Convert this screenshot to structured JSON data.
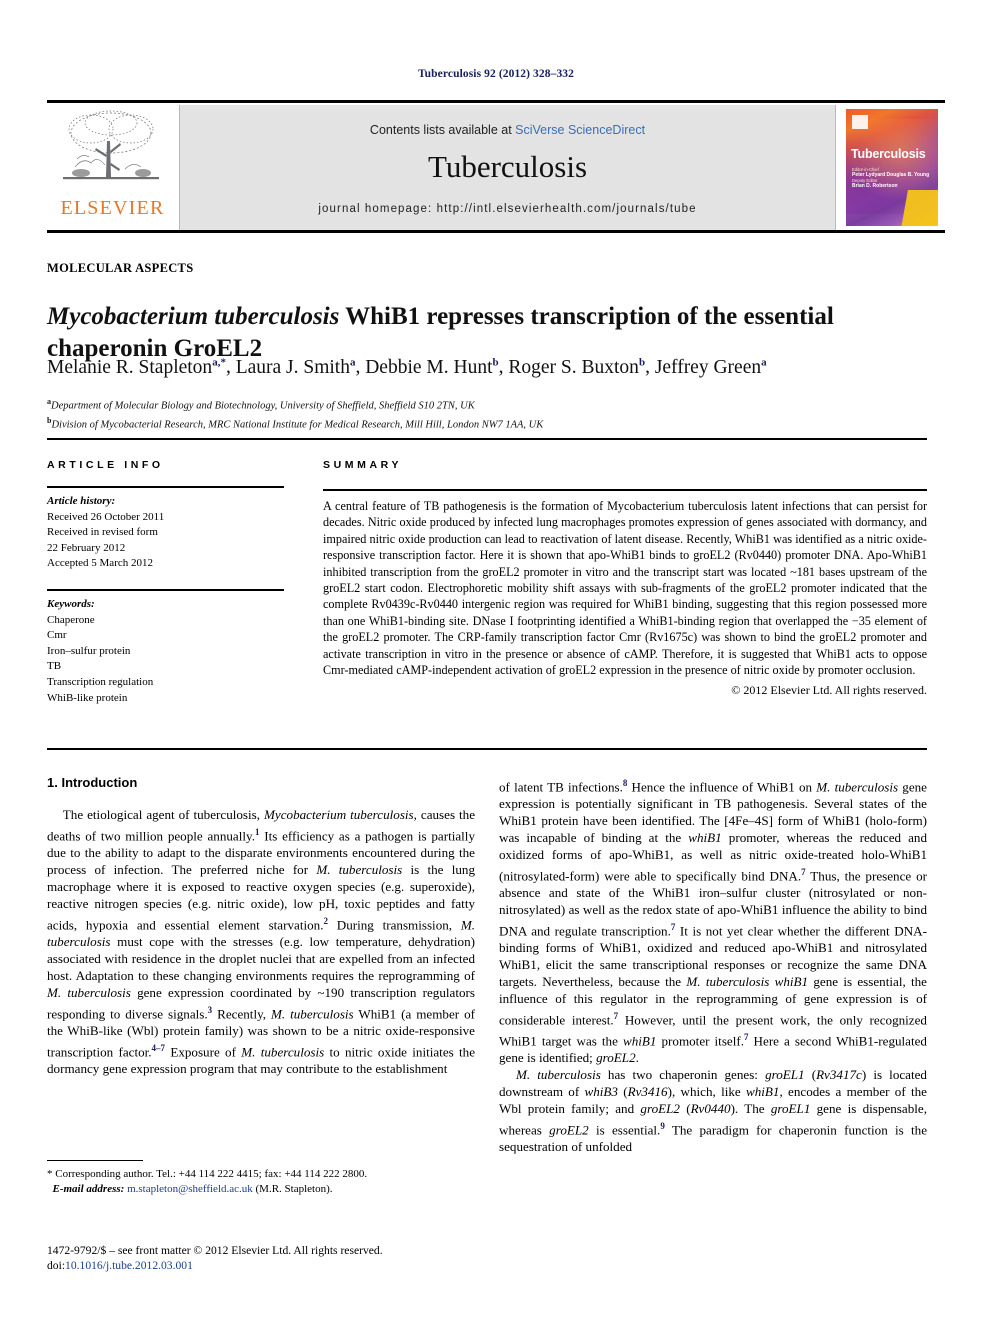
{
  "running_head": "Tuberculosis 92 (2012) 328–332",
  "masthead": {
    "contents_prefix": "Contents lists available at ",
    "sciencedirect": "SciVerse ScienceDirect",
    "journal_name": "Tuberculosis",
    "homepage": "journal homepage: http://intl.elsevierhealth.com/journals/tube",
    "publisher_wordmark": "ELSEVIER",
    "cover": {
      "title": "Tuberculosis",
      "editor_label": "Editor-in-Chief",
      "editors": "Peter Lydyard\nDouglas B. Young",
      "deputy_label": "Deputy Editor",
      "deputy": "Brian D. Robertson",
      "colors": {
        "orange": "#f05a28",
        "purple": "#8e44ad",
        "yellow": "#f5c518"
      }
    }
  },
  "section_label": "MOLECULAR ASPECTS",
  "title": {
    "italic_lead": "Mycobacterium tuberculosis",
    "rest": " WhiB1 represses transcription of the essential chaperonin GroEL2"
  },
  "authors": [
    {
      "name": "Melanie R. Stapleton",
      "marks": "a,*"
    },
    {
      "name": "Laura J. Smith",
      "marks": "a"
    },
    {
      "name": "Debbie M. Hunt",
      "marks": "b"
    },
    {
      "name": "Roger S. Buxton",
      "marks": "b"
    },
    {
      "name": "Jeffrey Green",
      "marks": "a"
    }
  ],
  "affiliations": [
    {
      "mark": "a",
      "text": "Department of Molecular Biology and Biotechnology, University of Sheffield, Sheffield S10 2TN, UK"
    },
    {
      "mark": "b",
      "text": "Division of Mycobacterial Research, MRC National Institute for Medical Research, Mill Hill, London NW7 1AA, UK"
    }
  ],
  "info_header": "ARTICLE INFO",
  "summary_header": "SUMMARY",
  "article_history": {
    "label": "Article history:",
    "lines": [
      "Received 26 October 2011",
      "Received in revised form",
      "22 February 2012",
      "Accepted 5 March 2012"
    ]
  },
  "keywords": {
    "label": "Keywords:",
    "items": [
      "Chaperone",
      "Cmr",
      "Iron–sulfur protein",
      "TB",
      "Transcription regulation",
      "WhiB-like protein"
    ]
  },
  "summary": {
    "paragraph": "A central feature of TB pathogenesis is the formation of Mycobacterium tuberculosis latent infections that can persist for decades. Nitric oxide produced by infected lung macrophages promotes expression of genes associated with dormancy, and impaired nitric oxide production can lead to reactivation of latent disease. Recently, WhiB1 was identified as a nitric oxide-responsive transcription factor. Here it is shown that apo-WhiB1 binds to groEL2 (Rv0440) promoter DNA. Apo-WhiB1 inhibited transcription from the groEL2 promoter in vitro and the transcript start was located ~181 bases upstream of the groEL2 start codon. Electrophoretic mobility shift assays with sub-fragments of the groEL2 promoter indicated that the complete Rv0439c-Rv0440 intergenic region was required for WhiB1 binding, suggesting that this region possessed more than one WhiB1-binding site. DNase I footprinting identified a WhiB1-binding region that overlapped the −35 element of the groEL2 promoter. The CRP-family transcription factor Cmr (Rv1675c) was shown to bind the groEL2 promoter and activate transcription in vitro in the presence or absence of cAMP. Therefore, it is suggested that WhiB1 acts to oppose Cmr-mediated cAMP-independent activation of groEL2 expression in the presence of nitric oxide by promoter occlusion.",
    "copyright": "© 2012 Elsevier Ltd. All rights reserved."
  },
  "intro_heading": "1. Introduction",
  "footnote": {
    "corresponding": "* Corresponding author. Tel.: +44 114 222 4415; fax: +44 114 222 2800.",
    "email_label": "E-mail address:",
    "email": "m.stapleton@sheffield.ac.uk",
    "email_suffix": " (M.R. Stapleton)."
  },
  "footer": {
    "front_matter": "1472-9792/$ – see front matter © 2012 Elsevier Ltd. All rights reserved.",
    "doi_label": "doi:",
    "doi": "10.1016/j.tube.2012.03.001"
  }
}
